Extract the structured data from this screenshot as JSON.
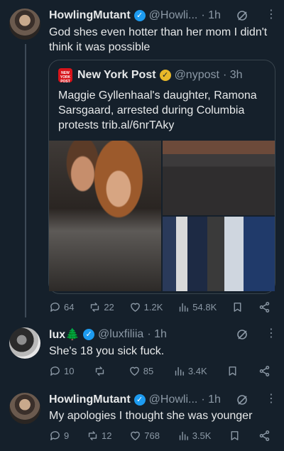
{
  "tweets": [
    {
      "name": "HowlingMutant",
      "handle": "@Howli...",
      "time": "· 1h",
      "text": "God shes even hotter than her mom I didn't think it was possible",
      "quote": {
        "name": "New York Post",
        "handle": "@nypost",
        "time": "· 3h",
        "logo_text": "NEW YORK POST",
        "text": "Maggie Gyllenhaal's daughter, Ramona Sarsgaard, arrested during Columbia protests trib.al/6nrTAky"
      },
      "replies": "64",
      "reposts": "22",
      "likes": "1.2K",
      "views": "54.8K"
    },
    {
      "name": "lux🌲",
      "handle": "@luxfiliia",
      "time": "· 1h",
      "text": "She's 18 you sick fuck.",
      "replies": "10",
      "reposts": "",
      "likes": "85",
      "views": "3.4K"
    },
    {
      "name": "HowlingMutant",
      "handle": "@Howli...",
      "time": "· 1h",
      "text": "My apologies I thought she was younger",
      "replies": "9",
      "reposts": "12",
      "likes": "768",
      "views": "3.5K"
    }
  ],
  "icons": {
    "verified": "verified-badge-icon",
    "grok": "grok-icon",
    "more": "more-icon",
    "reply": "reply-icon",
    "repost": "repost-icon",
    "like": "heart-icon",
    "views": "views-icon",
    "bookmark": "bookmark-icon",
    "share": "share-icon"
  },
  "colors": {
    "background": "#15202b",
    "text": "#e7e9ea",
    "muted": "#8b98a5",
    "verified_blue": "#1d9bf0",
    "verified_gold": "#e8b829"
  }
}
